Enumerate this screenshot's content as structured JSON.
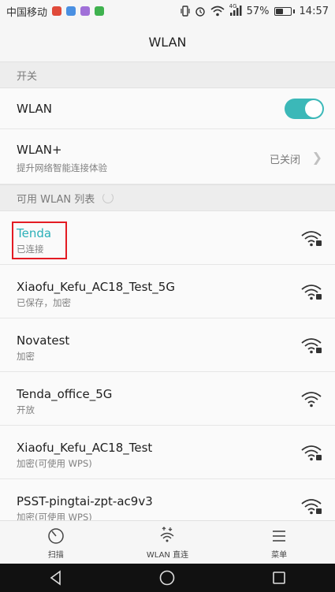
{
  "status_bar": {
    "carrier": "中国移动",
    "network_type": "4G",
    "battery": "57%",
    "battery_level": 0.57,
    "time": "14:57"
  },
  "header": {
    "title": "WLAN"
  },
  "switch_section": {
    "header": "开关",
    "wlan_label": "WLAN",
    "wlan_enabled": true,
    "wlan_plus_label": "WLAN+",
    "wlan_plus_subtitle": "提升网络智能连接体验",
    "wlan_plus_value": "已关闭"
  },
  "networks_section": {
    "header": "可用 WLAN 列表",
    "networks": [
      {
        "name": "Tenda",
        "status": "已连接",
        "connected": true,
        "secured": true
      },
      {
        "name": "Xiaofu_Kefu_AC18_Test_5G",
        "status": "已保存，加密",
        "connected": false,
        "secured": true
      },
      {
        "name": "Novatest",
        "status": "加密",
        "connected": false,
        "secured": true
      },
      {
        "name": "Tenda_office_5G",
        "status": "开放",
        "connected": false,
        "secured": false
      },
      {
        "name": "Xiaofu_Kefu_AC18_Test",
        "status": "加密(可使用 WPS)",
        "connected": false,
        "secured": true
      },
      {
        "name": "PSST-pingtai-zpt-ac9v3",
        "status": "加密(可使用 WPS)",
        "connected": false,
        "secured": true
      }
    ]
  },
  "bottom_tabs": {
    "scan": "扫描",
    "wlan_direct": "WLAN 直连",
    "menu": "菜单"
  },
  "colors": {
    "accent": "#3bb8b8",
    "connected_text": "#2bb0b8",
    "highlight": "#e31b23"
  }
}
